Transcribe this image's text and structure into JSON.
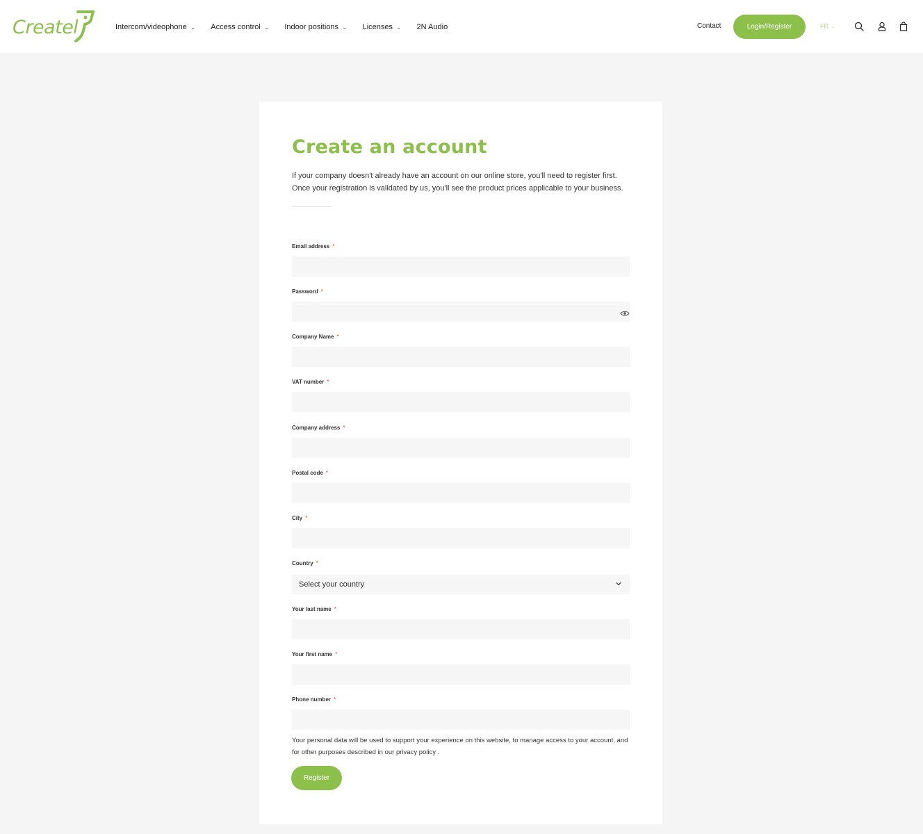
{
  "brand": {
    "logo_text": "Createl",
    "accent_color": "#8cc04b"
  },
  "nav": {
    "items": [
      {
        "label": "Intercom/videophone",
        "has_dropdown": true
      },
      {
        "label": "Access control",
        "has_dropdown": true
      },
      {
        "label": "Indoor positions",
        "has_dropdown": true
      },
      {
        "label": "Licenses",
        "has_dropdown": true
      },
      {
        "label": "2N Audio",
        "has_dropdown": false
      }
    ],
    "contact_label": "Contact",
    "login_label": "Login/Register",
    "language": "FR",
    "icons": [
      "search-icon",
      "user-icon",
      "cart-icon"
    ]
  },
  "form": {
    "title": "Create an account",
    "intro": "If your company doesn't already have an account on our online store, you'll need to register first. Once your registration is validated by us, you'll see the product prices applicable to your business.",
    "required_mark": "*",
    "fields": [
      {
        "label": "Email address",
        "value": ""
      },
      {
        "label": "Password",
        "value": ""
      },
      {
        "label": "Company Name",
        "value": ""
      },
      {
        "label": "VAT number",
        "value": ""
      },
      {
        "label": "Company address",
        "value": ""
      },
      {
        "label": "Postal code",
        "value": ""
      },
      {
        "label": "City",
        "value": ""
      },
      {
        "label": "Country",
        "value": "Select your country"
      },
      {
        "label": "Your last name",
        "value": ""
      },
      {
        "label": "Your first name",
        "value": ""
      },
      {
        "label": "Phone number",
        "value": ""
      }
    ],
    "privacy_text": "Your personal data will be used to support your experience on this website, to manage access to your account, and for other purposes described in our ",
    "privacy_link": "privacy policy",
    "privacy_suffix": " .",
    "register_label": "Register"
  }
}
